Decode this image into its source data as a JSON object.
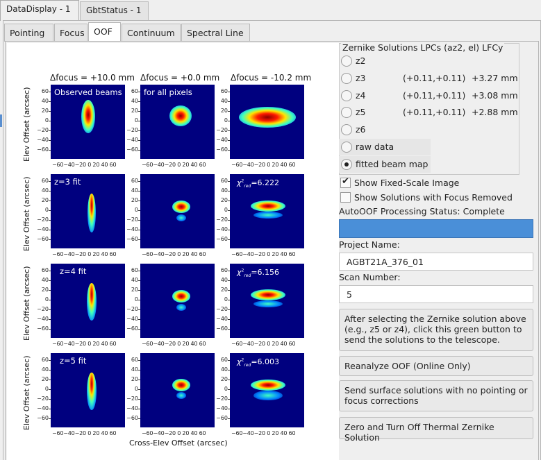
{
  "window_tabs": [
    "DataDisplay - 1",
    "GbtStatus - 1"
  ],
  "sub_tabs": [
    "Pointing",
    "Focus",
    "OOF",
    "Continuum",
    "Spectral Line"
  ],
  "plots": {
    "column_titles": [
      "Δfocus = +10.0 mm",
      "Δfocus = +0.0 mm",
      "Δfocus = -10.2 mm"
    ],
    "row_ylabel": "Elev Offset (arcsec)",
    "xlabel": "Cross-Elev Offset (arcsec)",
    "yticks": [
      "60",
      "40",
      "20",
      "0",
      "−20",
      "−40",
      "−60"
    ],
    "xticks": "−60−40−20  0  20  40  60",
    "labels": {
      "observed": "Observed beams",
      "all_pixels": "for all pixels",
      "z3": "z=3 fit",
      "z4": "z=4 fit",
      "z5": "z=5 fit"
    },
    "chi_symbol": "χ",
    "chi_sup": "2",
    "chi_sub": "red",
    "chi_values": [
      "=6.222",
      "=6.156",
      "=6.003"
    ]
  },
  "zernike": {
    "title": "Zernike Solutions   LPCs (az2, el)   LFCy",
    "options": [
      {
        "label": "z2",
        "lpc": "",
        "lfc": "",
        "selected": false
      },
      {
        "label": "z3",
        "lpc": "(+0.11,+0.11)",
        "lfc": "+3.27 mm",
        "selected": false
      },
      {
        "label": "z4",
        "lpc": "(+0.11,+0.11)",
        "lfc": "+3.08 mm",
        "selected": false
      },
      {
        "label": "z5",
        "lpc": "(+0.11,+0.11)",
        "lfc": "+2.88 mm",
        "selected": false
      },
      {
        "label": "z6",
        "lpc": "",
        "lfc": "",
        "selected": false
      },
      {
        "label": "raw data",
        "lpc": "",
        "lfc": "",
        "selected": false
      },
      {
        "label": "fitted beam map",
        "lpc": "",
        "lfc": "",
        "selected": true
      }
    ]
  },
  "checkboxes": {
    "fixed_scale": {
      "label": "Show Fixed-Scale Image",
      "checked": true
    },
    "focus_removed": {
      "label": "Show Solutions with Focus Removed",
      "checked": false
    }
  },
  "status_text": "AutoOOF Processing Status: Complete",
  "project": {
    "label": "Project Name:",
    "value": "AGBT21A_376_01"
  },
  "scan": {
    "label": "Scan Number:",
    "value": "5"
  },
  "buttons": {
    "send_solutions": "After selecting the Zernike solution above (e.g., z5 or z4), click this green button to send the solutions to the telescope.",
    "reanalyze": "Reanalyze OOF (Online Only)",
    "send_surface": "Send surface solutions with no pointing or focus corrections",
    "zero_thermal": "Zero and Turn Off Thermal Zernike Solution"
  }
}
